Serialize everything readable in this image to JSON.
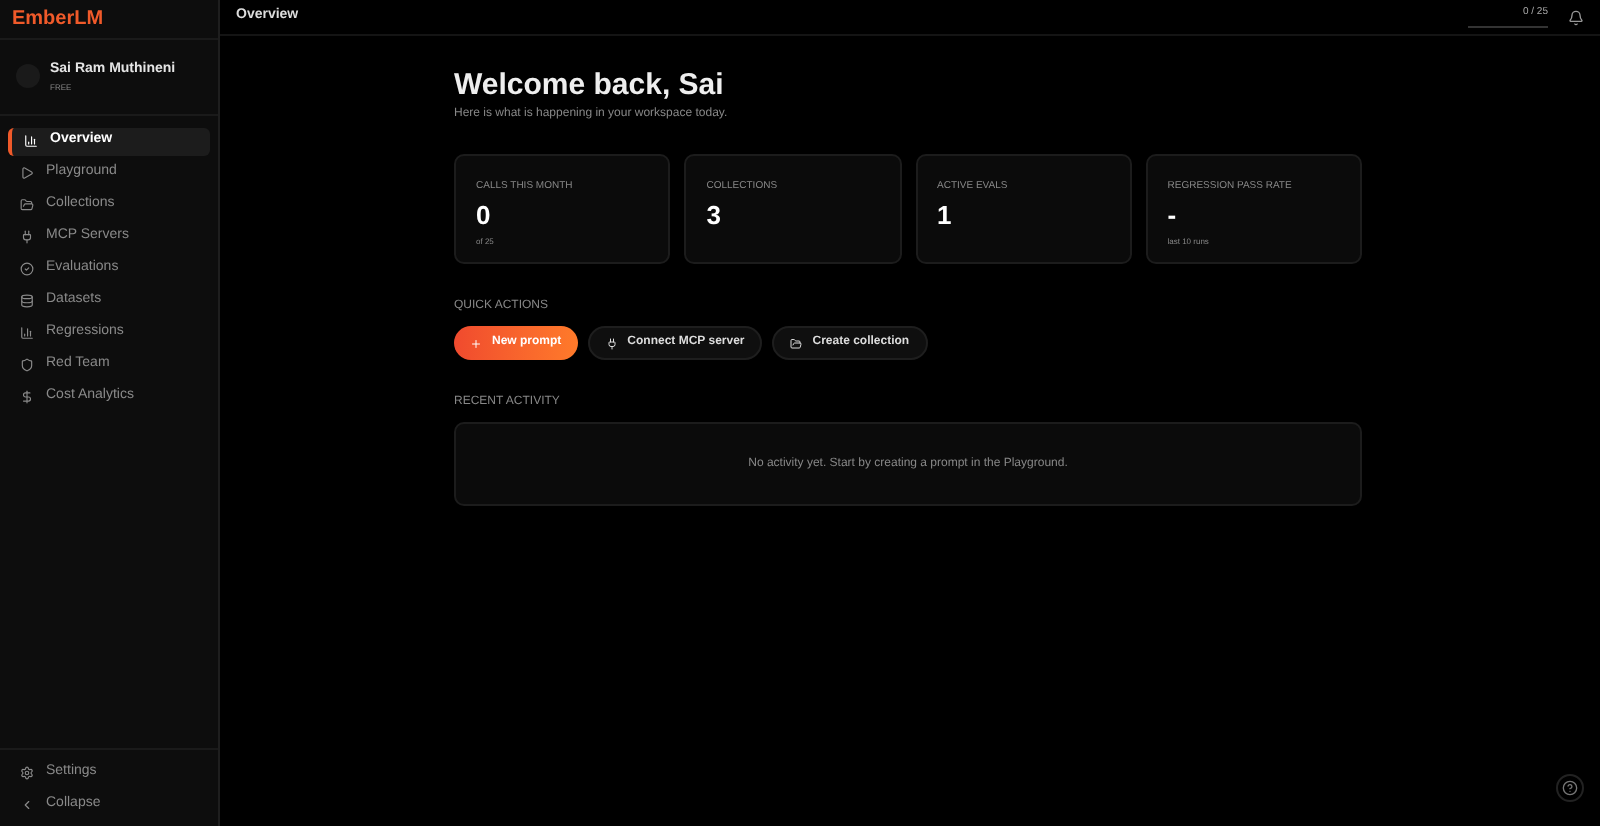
{
  "brand": "EmberLM",
  "user": {
    "name": "Sai Ram Muthineni",
    "plan": "FREE"
  },
  "nav": [
    {
      "label": "Overview",
      "selected": true
    },
    {
      "label": "Playground",
      "selected": false
    },
    {
      "label": "Collections",
      "selected": false
    },
    {
      "label": "MCP Servers",
      "selected": false
    },
    {
      "label": "Evaluations",
      "selected": false
    },
    {
      "label": "Datasets",
      "selected": false
    },
    {
      "label": "Regressions",
      "selected": false
    },
    {
      "label": "Red Team",
      "selected": false
    },
    {
      "label": "Cost Analytics",
      "selected": false
    }
  ],
  "sidebar_footer": [
    {
      "label": "Settings"
    },
    {
      "label": "Collapse"
    }
  ],
  "header": {
    "title": "Overview",
    "usage": {
      "text": "0 / 25",
      "level": 0
    }
  },
  "welcome": {
    "title": "Welcome back, Sai",
    "subtitle": "Here is what is happening in your workspace today."
  },
  "stats": [
    {
      "label": "CALLS THIS MONTH",
      "value": "0",
      "note": "of 25"
    },
    {
      "label": "COLLECTIONS",
      "value": "3"
    },
    {
      "label": "ACTIVE EVALS",
      "value": "1"
    },
    {
      "label": "REGRESSION PASS RATE",
      "value": "-",
      "note": "last 10 runs"
    }
  ],
  "quick_actions": {
    "heading": "QUICK ACTIONS",
    "buttons": [
      {
        "label": "New prompt",
        "kind": "primary"
      },
      {
        "label": "Connect MCP server",
        "kind": "secondary"
      },
      {
        "label": "Create collection",
        "kind": "secondary"
      }
    ]
  },
  "recent_activity": {
    "heading": "RECENT ACTIVITY",
    "empty": "No activity yet. Start by creating a prompt in the Playground."
  }
}
